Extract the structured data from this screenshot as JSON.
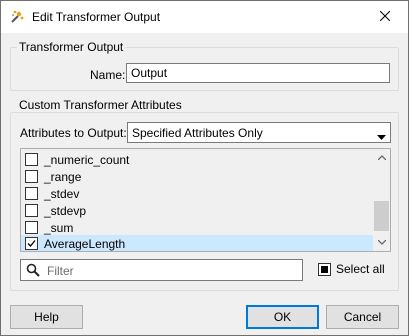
{
  "window": {
    "title": "Edit Transformer Output"
  },
  "transformer_output": {
    "group_label": "Transformer Output",
    "name_label": "Name:",
    "name_value": "Output"
  },
  "custom_attributes": {
    "group_label": "Custom Transformer Attributes",
    "output_label": "Attributes to Output:",
    "output_value": "Specified Attributes Only",
    "items": [
      {
        "label": "_numeric_count",
        "checked": false,
        "selected": false
      },
      {
        "label": "_range",
        "checked": false,
        "selected": false
      },
      {
        "label": "_stdev",
        "checked": false,
        "selected": false
      },
      {
        "label": "_stdevp",
        "checked": false,
        "selected": false
      },
      {
        "label": "_sum",
        "checked": false,
        "selected": false
      },
      {
        "label": "AverageLength",
        "checked": true,
        "selected": true
      }
    ],
    "filter_placeholder": "Filter",
    "select_all_label": "Select all",
    "select_all_state": "indeterminate"
  },
  "buttons": {
    "help": "Help",
    "ok": "OK",
    "cancel": "Cancel"
  },
  "icons": {
    "app": "transformer-wand-icon",
    "close": "close-icon",
    "dropdown": "chevron-down-icon",
    "search": "search-icon"
  },
  "colors": {
    "selection": "#cce8ff",
    "accent": "#0078d7"
  }
}
